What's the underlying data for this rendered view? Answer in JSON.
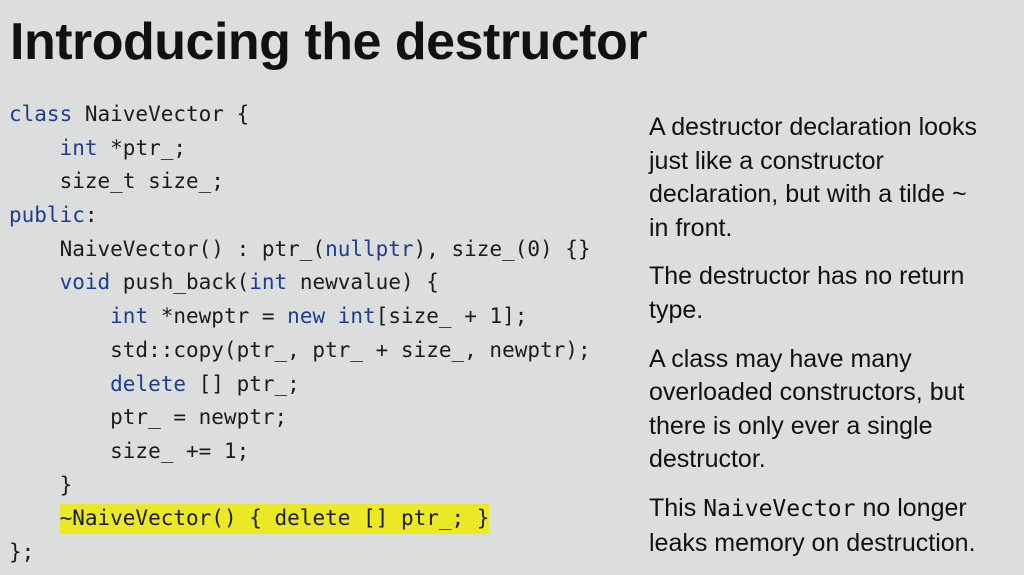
{
  "slide": {
    "title": "Introducing the destructor",
    "code_lines": [
      [
        {
          "t": "class",
          "kw": true
        },
        {
          "t": " NaiveVector {"
        }
      ],
      [
        {
          "t": "    "
        },
        {
          "t": "int",
          "kw": true
        },
        {
          "t": " *ptr_;"
        }
      ],
      [
        {
          "t": "    size_t size_;"
        }
      ],
      [
        {
          "t": "public",
          "kw": true
        },
        {
          "t": ":"
        }
      ],
      [
        {
          "t": "    NaiveVector() : ptr_("
        },
        {
          "t": "nullptr",
          "kw": true
        },
        {
          "t": "), size_(0) {}"
        }
      ],
      [
        {
          "t": "    "
        },
        {
          "t": "void",
          "kw": true
        },
        {
          "t": " push_back("
        },
        {
          "t": "int",
          "kw": true
        },
        {
          "t": " newvalue) {"
        }
      ],
      [
        {
          "t": "        "
        },
        {
          "t": "int",
          "kw": true
        },
        {
          "t": " *newptr = "
        },
        {
          "t": "new",
          "kw": true
        },
        {
          "t": " "
        },
        {
          "t": "int",
          "kw": true
        },
        {
          "t": "[size_ + 1];"
        }
      ],
      [
        {
          "t": "        std::copy(ptr_, ptr_ + size_, newptr);"
        }
      ],
      [
        {
          "t": "        "
        },
        {
          "t": "delete",
          "kw": true
        },
        {
          "t": " [] ptr_;"
        }
      ],
      [
        {
          "t": "        ptr_ = newptr;"
        }
      ],
      [
        {
          "t": "        size_ += 1;"
        }
      ],
      [
        {
          "t": "    }"
        }
      ],
      [
        {
          "t": "    "
        },
        {
          "t": "~NaiveVector() { delete [] ptr_; }",
          "hl": true
        }
      ],
      [
        {
          "t": "};"
        }
      ]
    ],
    "paragraphs": [
      [
        [
          {
            "t": "A destructor declaration looks"
          }
        ],
        [
          {
            "t": "just like a constructor"
          }
        ],
        [
          {
            "t": "declaration, but with a tilde ~"
          }
        ],
        [
          {
            "t": "in front."
          }
        ]
      ],
      [
        [
          {
            "t": "The destructor has no return"
          }
        ],
        [
          {
            "t": "type."
          }
        ]
      ],
      [
        [
          {
            "t": "A class may have many"
          }
        ],
        [
          {
            "t": "overloaded constructors, but"
          }
        ],
        [
          {
            "t": "there is only ever a single"
          }
        ],
        [
          {
            "t": "destructor."
          }
        ]
      ],
      [
        [
          {
            "t": "This "
          },
          {
            "t": "NaiveVector",
            "mono": true
          },
          {
            "t": " no longer"
          }
        ],
        [
          {
            "t": "leaks memory on destruction."
          }
        ]
      ]
    ]
  }
}
